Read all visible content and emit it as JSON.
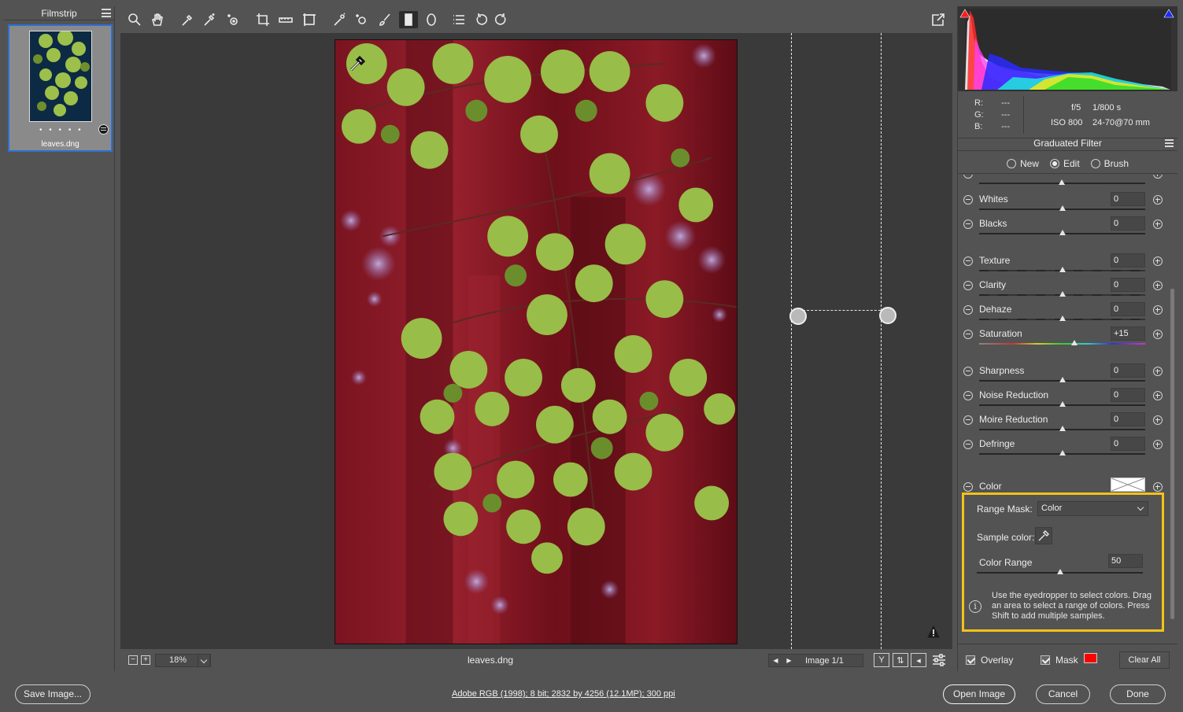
{
  "filmstrip": {
    "title": "Filmstrip",
    "thumbnail": {
      "filename": "leaves.dng",
      "rating_dots": "• • • • •"
    }
  },
  "toolbar": {
    "tools": [
      "zoom-tool",
      "hand-tool",
      "white-balance-tool",
      "color-sampler-tool",
      "targeted-adjustment-tool",
      "crop-tool",
      "straighten-tool",
      "transform-tool",
      "spot-removal-tool",
      "red-eye-tool",
      "adjustment-brush-tool",
      "graduated-filter-tool",
      "radial-filter-tool",
      "presets-list",
      "rotate-left",
      "rotate-right"
    ],
    "active_tool": "graduated-filter-tool",
    "fullscreen_icon": "fullscreen-icon"
  },
  "preview": {
    "filename": "leaves.dng",
    "zoom": "18%",
    "image_counter": "Image 1/1",
    "overlay_mask_color": "#8b1a24"
  },
  "histogram": {
    "rgb": {
      "r_label": "R:",
      "g_label": "G:",
      "b_label": "B:",
      "r": "---",
      "g": "---",
      "b": "---"
    },
    "exif": {
      "aperture": "f/5",
      "shutter": "1/800 s",
      "iso": "ISO 800",
      "lens": "24-70@70 mm"
    }
  },
  "panel": {
    "title": "Graduated Filter",
    "modes": [
      {
        "label": "New",
        "selected": false
      },
      {
        "label": "Edit",
        "selected": true
      },
      {
        "label": "Brush",
        "selected": false
      }
    ],
    "adjustments": [
      {
        "label": "Whites",
        "value": "0",
        "level": 0.5
      },
      {
        "label": "Blacks",
        "value": "0",
        "level": 0.5
      },
      {
        "label": "Texture",
        "value": "0",
        "level": 0.5
      },
      {
        "label": "Clarity",
        "value": "0",
        "level": 0.5
      },
      {
        "label": "Dehaze",
        "value": "0",
        "level": 0.5
      },
      {
        "label": "Saturation",
        "value": "+15",
        "level": 0.575
      },
      {
        "label": "Sharpness",
        "value": "0",
        "level": 0.5
      },
      {
        "label": "Noise Reduction",
        "value": "0",
        "level": 0.5
      },
      {
        "label": "Moire Reduction",
        "value": "0",
        "level": 0.5
      },
      {
        "label": "Defringe",
        "value": "0",
        "level": 0.5
      }
    ],
    "color_label": "Color",
    "range_mask": {
      "label": "Range Mask:",
      "value": "Color",
      "sample_label": "Sample color:",
      "range_label": "Color Range",
      "range_value": "50",
      "range_level": 0.5,
      "help": "Use the eyedropper to select colors. Drag an area to select a range of colors. Press Shift to add multiple samples."
    },
    "overlay_label": "Overlay",
    "mask_label": "Mask",
    "mask_color": "#ff0000",
    "clear_all": "Clear All"
  },
  "footer": {
    "save_image": "Save Image...",
    "workflow": "Adobe RGB (1998); 8 bit; 2832 by 4256 (12.1MP); 300 ppi",
    "open_image": "Open Image",
    "cancel": "Cancel",
    "done": "Done"
  },
  "colors": {
    "highlight_box": "#f2c318",
    "selection_blue": "#2d6fd6"
  }
}
